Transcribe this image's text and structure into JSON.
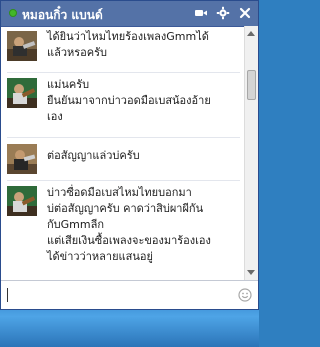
{
  "chat": {
    "contact_name": "หมอนกิ๋ว แบนด์",
    "status_color": "#42b72a",
    "accent_color": "#5472a7",
    "header_icons": [
      "video-call-icon",
      "gear-icon",
      "close-icon"
    ]
  },
  "messages": [
    {
      "lines": [
        "ได้ยินว่าไหมไทยร้องเพลงGmmได้",
        "แล้วหรอครับ"
      ]
    },
    {
      "lines": [
        "แม่นครับ",
        "ยืนยันมาจากบ่าวอดมือเบสน้องอ้าย",
        "เอง"
      ]
    },
    {
      "lines": [
        "ต่อสัญญาแล่วบ่ครับ"
      ]
    },
    {
      "lines": [
        "บ่าวซื่อดมือเบสไหมไทยบอกมา",
        "บ่ต่อสัญญาครับ คาดว่าสิบ่ผาผีกัน",
        "กับGmmลีก",
        "แต่เสียเงินซื้อเพลงจะของมาร้องเอง",
        "ได้ข่าวว่าหลายแสนอยู่"
      ]
    }
  ],
  "input": {
    "value": "",
    "placeholder": ""
  }
}
